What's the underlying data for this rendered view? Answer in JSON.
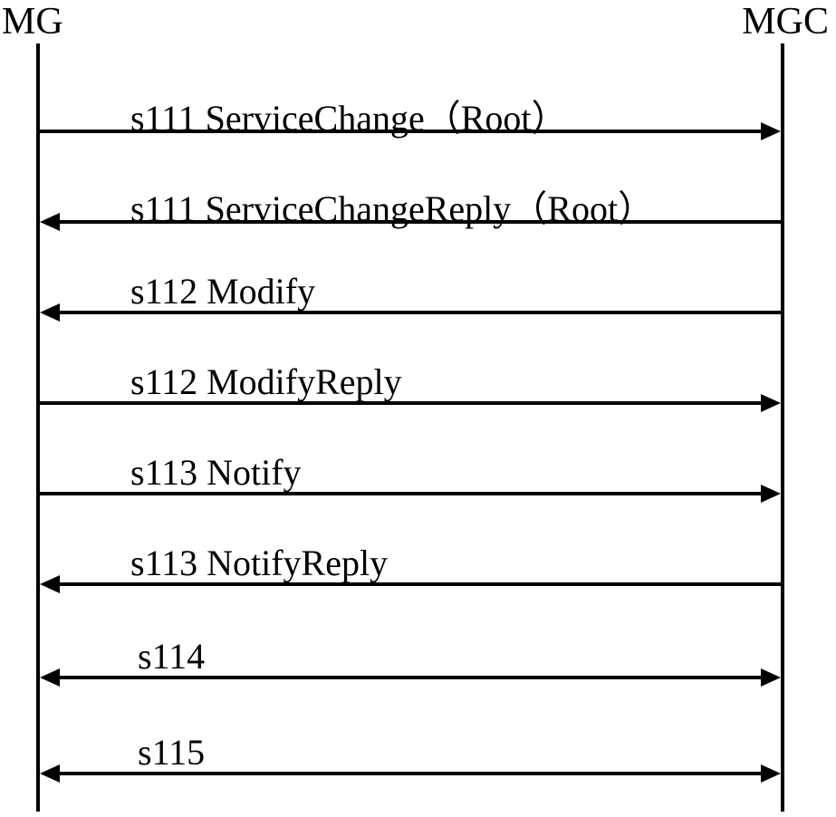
{
  "participants": {
    "left": "MG",
    "right": "MGC"
  },
  "messages": [
    {
      "label": "s111 ServiceChange（Root）",
      "direction": "right"
    },
    {
      "label": "s111 ServiceChangeReply（Root）",
      "direction": "left"
    },
    {
      "label": "s112 Modify",
      "direction": "left"
    },
    {
      "label": "s112 ModifyReply",
      "direction": "right"
    },
    {
      "label": "s113 Notify",
      "direction": "right"
    },
    {
      "label": "s113 NotifyReply",
      "direction": "left"
    },
    {
      "label": "s114",
      "direction": "both"
    },
    {
      "label": "s115",
      "direction": "both"
    }
  ],
  "chart_data": {
    "type": "diagram",
    "subtype": "sequence",
    "participants": [
      "MG",
      "MGC"
    ],
    "messages": [
      {
        "id": "s111",
        "name": "ServiceChange",
        "arg": "Root",
        "from": "MG",
        "to": "MGC"
      },
      {
        "id": "s111",
        "name": "ServiceChangeReply",
        "arg": "Root",
        "from": "MGC",
        "to": "MG"
      },
      {
        "id": "s112",
        "name": "Modify",
        "from": "MGC",
        "to": "MG"
      },
      {
        "id": "s112",
        "name": "ModifyReply",
        "from": "MG",
        "to": "MGC"
      },
      {
        "id": "s113",
        "name": "Notify",
        "from": "MG",
        "to": "MGC"
      },
      {
        "id": "s113",
        "name": "NotifyReply",
        "from": "MGC",
        "to": "MG"
      },
      {
        "id": "s114",
        "name": "",
        "from": "MG",
        "to": "MGC",
        "bidirectional": true
      },
      {
        "id": "s115",
        "name": "",
        "from": "MG",
        "to": "MGC",
        "bidirectional": true
      }
    ]
  }
}
